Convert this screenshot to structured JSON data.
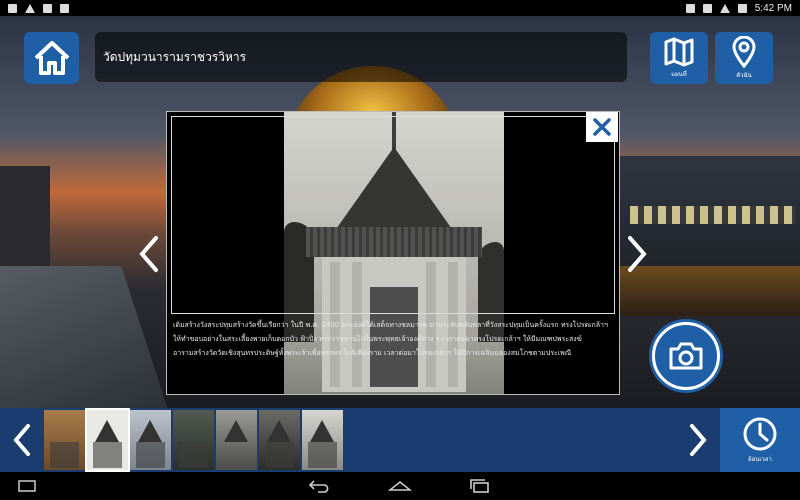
{
  "status_bar": {
    "time": "5:42 PM"
  },
  "header": {
    "title": "วัดปทุมวนารามราชวรวิหาร",
    "map_label": "แผนที่",
    "location_label": "ตัวฉัน"
  },
  "modal": {
    "caption_lines": [
      "เดิมสร้างวังสระปทุมสร้างวัดขึ้นเรียกว่า ในปี พ.ศ. 2400 พระองค์ได้เสด็จทางชลมารค มาประทับพลับพลาที่วังสระปทุมเป็นครั้งแรก ทรงโปรดเกล้าฯ",
      "ให้ทำขอบอย่างในสระเลี้ยงพายเก็บดอกบัว ฟ้าปิ่ง พระราชทานไปในพระพุทธเจ้าองค์ต่าง ๆ เวลาต่อมาทรงโปรดเกล้าฯ ให้มีมณฑปพระสงฆ์",
      "อารามสร้างวัดวัดเชิงสุนทรประดิษฐ์ทั้งพระเจ้าเพื่อทรงพร ใกล้เคียงราม เวลาต่อมาโปรดเกล้าฯ ให้มีการเฉลิมฉลองสมโภชตามประเพณี"
    ]
  },
  "bottom": {
    "time_label": "ย้อนเวลา"
  },
  "colors": {
    "accent_blue": "#1f5fa6",
    "strip_blue": "#1a3c6e"
  }
}
